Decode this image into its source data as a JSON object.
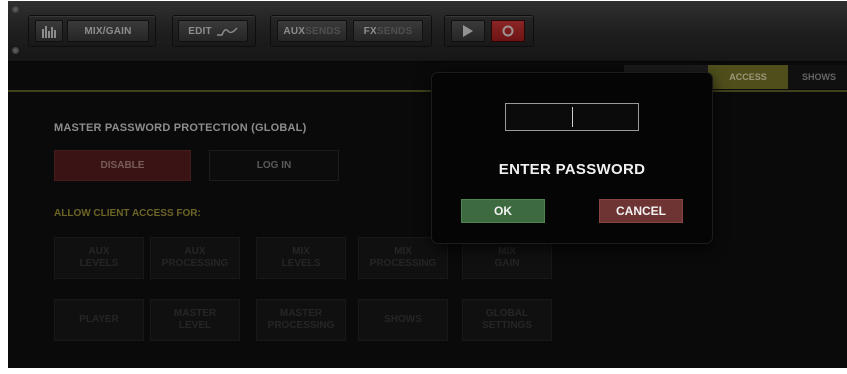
{
  "toolbar": {
    "meters_icon": "meters-icon",
    "mix_gain_label": "MIX/GAIN",
    "edit_label": "EDIT",
    "edit_icon": "eq-curve-icon",
    "aux_label": "AUX",
    "aux_sends_label": "SENDS",
    "fx_label": "FX",
    "fx_sends_label": "SENDS",
    "play_icon": "play-icon",
    "record_icon": "record-icon"
  },
  "tabs": [
    {
      "label": "",
      "active": false
    },
    {
      "label": "ACCESS",
      "active": true
    },
    {
      "label": "SHOWS",
      "active": false
    }
  ],
  "main": {
    "section_title": "MASTER PASSWORD PROTECTION (GLOBAL)",
    "disable_label": "DISABLE",
    "login_label": "LOG IN",
    "access_label": "ALLOW CLIENT ACCESS FOR:",
    "tiles_row1": [
      {
        "line1": "AUX",
        "line2": "LEVELS"
      },
      {
        "line1": "AUX",
        "line2": "PROCESSING"
      },
      {
        "line1": "MIX",
        "line2": "LEVELS"
      },
      {
        "line1": "MIX",
        "line2": "PROCESSING"
      },
      {
        "line1": "MIX",
        "line2": "GAIN"
      }
    ],
    "tiles_row2": [
      {
        "line1": "PLAYER",
        "line2": ""
      },
      {
        "line1": "MASTER",
        "line2": "LEVEL"
      },
      {
        "line1": "MASTER",
        "line2": "PROCESSING"
      },
      {
        "line1": "SHOWS",
        "line2": ""
      },
      {
        "line1": "GLOBAL",
        "line2": "SETTINGS"
      }
    ]
  },
  "dialog": {
    "password_value": "",
    "title": "ENTER PASSWORD",
    "ok_label": "OK",
    "cancel_label": "CANCEL"
  },
  "colors": {
    "ok_green": "#3d6a3f",
    "cancel_red": "#6e3434",
    "disable_red": "#5a2020",
    "access_yellow": "#a69a3a"
  }
}
